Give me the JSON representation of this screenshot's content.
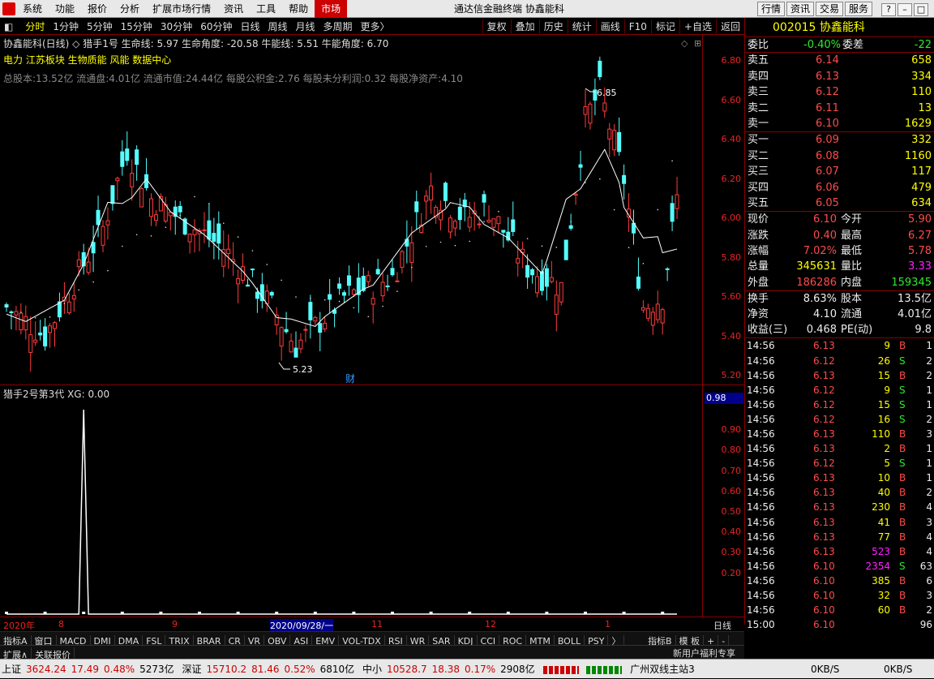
{
  "app": {
    "title": "通达信金融终端",
    "stock_title": "协鑫能科"
  },
  "menu": [
    "系统",
    "功能",
    "报价",
    "分析",
    "扩展市场行情",
    "资讯",
    "工具",
    "帮助",
    "市场"
  ],
  "top_buttons": [
    "行情",
    "资讯",
    "交易",
    "服务"
  ],
  "periods": [
    "分时",
    "1分钟",
    "5分钟",
    "15分钟",
    "30分钟",
    "60分钟",
    "日线",
    "周线",
    "月线",
    "多周期",
    "更多〉"
  ],
  "chart_tools": [
    "复权",
    "叠加",
    "历史",
    "统计",
    "画线",
    "F10",
    "标记",
    "+自选",
    "返回"
  ],
  "info": {
    "line1": "协鑫能科(日线) ◇ 猎手1号  生命线: 5.97  生命角度: -20.58  牛能线: 5.51  牛能角度: 6.70",
    "line2": "电力 江苏板块 生物质能 风能 数据中心",
    "line3": "总股本:13.52亿 流通盘:4.01亿 流通市值:24.44亿 每股公积金:2.76 每股未分利润:0.32 每股净资产:4.10"
  },
  "y_labels": [
    "6.80",
    "6.60",
    "6.40",
    "6.20",
    "6.00",
    "5.80",
    "5.60",
    "5.40",
    "5.20"
  ],
  "annotations": {
    "high": "6.85",
    "low": "5.23",
    "cai": "财"
  },
  "sub": {
    "title": "猎手2号第3代  XG: 0.00",
    "current": "0.98",
    "y_labels": [
      "0.90",
      "0.80",
      "0.70",
      "0.60",
      "0.50",
      "0.40",
      "0.30",
      "0.20"
    ]
  },
  "x_labels": [
    "2020年",
    "8",
    "9",
    "2020/09/28/一",
    "11",
    "12",
    "1"
  ],
  "x_right": "日线",
  "chart_data": {
    "type": "candlestick",
    "main_ylim": [
      5.2,
      6.85
    ],
    "high": 6.85,
    "low": 5.23,
    "indicator": {
      "name": "猎手2号第3代",
      "spike_index": 16,
      "ylim": [
        0,
        1.0
      ]
    }
  },
  "quote": {
    "code": "002015",
    "name": "协鑫能科",
    "weibi": {
      "label": "委比",
      "value": "-0.40%",
      "label2": "委差",
      "value2": "-22"
    },
    "asks": [
      {
        "l": "卖五",
        "p": "6.14",
        "v": "658"
      },
      {
        "l": "卖四",
        "p": "6.13",
        "v": "334"
      },
      {
        "l": "卖三",
        "p": "6.12",
        "v": "110"
      },
      {
        "l": "卖二",
        "p": "6.11",
        "v": "13"
      },
      {
        "l": "卖一",
        "p": "6.10",
        "v": "1629"
      }
    ],
    "bids": [
      {
        "l": "买一",
        "p": "6.09",
        "v": "332"
      },
      {
        "l": "买二",
        "p": "6.08",
        "v": "1160"
      },
      {
        "l": "买三",
        "p": "6.07",
        "v": "117"
      },
      {
        "l": "买四",
        "p": "6.06",
        "v": "479"
      },
      {
        "l": "买五",
        "p": "6.05",
        "v": "634"
      }
    ],
    "stats": [
      {
        "a": "现价",
        "av": "6.10",
        "b": "今开",
        "bv": "5.90",
        "ac": "red",
        "bc": "red"
      },
      {
        "a": "涨跌",
        "av": "0.40",
        "b": "最高",
        "bv": "6.27",
        "ac": "red",
        "bc": "red"
      },
      {
        "a": "涨幅",
        "av": "7.02%",
        "b": "最低",
        "bv": "5.78",
        "ac": "red",
        "bc": "red"
      },
      {
        "a": "总量",
        "av": "345631",
        "b": "量比",
        "bv": "3.33",
        "ac": "yel",
        "bc": "mag"
      },
      {
        "a": "外盘",
        "av": "186286",
        "b": "内盘",
        "bv": "159345",
        "ac": "red",
        "bc": "grn"
      },
      {
        "a": "换手",
        "av": "8.63%",
        "b": "股本",
        "bv": "13.5亿",
        "ac": "wht",
        "bc": "wht"
      },
      {
        "a": "净资",
        "av": "4.10",
        "b": "流通",
        "bv": "4.01亿",
        "ac": "wht",
        "bc": "wht"
      },
      {
        "a": "收益(三)",
        "av": "0.468",
        "b": "PE(动)",
        "bv": "9.8",
        "ac": "wht",
        "bc": "wht"
      }
    ],
    "ticks": [
      [
        "14:56",
        "6.13",
        "9",
        "B",
        "1"
      ],
      [
        "14:56",
        "6.12",
        "26",
        "S",
        "2"
      ],
      [
        "14:56",
        "6.13",
        "15",
        "B",
        "2"
      ],
      [
        "14:56",
        "6.12",
        "9",
        "S",
        "1"
      ],
      [
        "14:56",
        "6.12",
        "15",
        "S",
        "1"
      ],
      [
        "14:56",
        "6.12",
        "16",
        "S",
        "2"
      ],
      [
        "14:56",
        "6.13",
        "110",
        "B",
        "3"
      ],
      [
        "14:56",
        "6.13",
        "2",
        "B",
        "1"
      ],
      [
        "14:56",
        "6.12",
        "5",
        "S",
        "1"
      ],
      [
        "14:56",
        "6.13",
        "10",
        "B",
        "1"
      ],
      [
        "14:56",
        "6.13",
        "40",
        "B",
        "2"
      ],
      [
        "14:56",
        "6.13",
        "230",
        "B",
        "4"
      ],
      [
        "14:56",
        "6.13",
        "41",
        "B",
        "3"
      ],
      [
        "14:56",
        "6.13",
        "77",
        "B",
        "4"
      ],
      [
        "14:56",
        "6.13",
        "523",
        "B",
        "4"
      ],
      [
        "14:56",
        "6.10",
        "2354",
        "S",
        "63"
      ],
      [
        "14:56",
        "6.10",
        "385",
        "B",
        "6"
      ],
      [
        "14:56",
        "6.10",
        "32",
        "B",
        "3"
      ],
      [
        "14:56",
        "6.10",
        "60",
        "B",
        "2"
      ],
      [
        "15:00",
        "6.10",
        "",
        "",
        "96"
      ]
    ]
  },
  "bottom_tabs": [
    "指标A",
    "窗口",
    "MACD",
    "DMI",
    "DMA",
    "FSL",
    "TRIX",
    "BRAR",
    "CR",
    "VR",
    "OBV",
    "ASI",
    "EMV",
    "VOL-TDX",
    "RSI",
    "WR",
    "SAR",
    "KDJ",
    "CCI",
    "ROC",
    "MTM",
    "BOLL",
    "PSY",
    "〉"
  ],
  "bottom_right": [
    "指标B",
    "模 板",
    "+",
    "-"
  ],
  "sub_tabs": [
    "扩展∧",
    "关联报价"
  ],
  "promo": "新用户福利专享",
  "status": {
    "sh": "上证",
    "sh_val": "3624.24",
    "sh_chg": "17.49",
    "sh_pct": "0.48%",
    "sh_amt": "5273亿",
    "sz": "深证",
    "sz_val": "15710.2",
    "sz_chg": "81.46",
    "sz_pct": "0.52%",
    "sz_amt": "6810亿",
    "zx": "中小",
    "zx_val": "10528.7",
    "zx_chg": "18.38",
    "zx_pct": "0.17%",
    "zx_amt": "2908亿",
    "site": "广州双线主站3"
  },
  "net": {
    "down": "0KB/S",
    "up": "0KB/S"
  }
}
